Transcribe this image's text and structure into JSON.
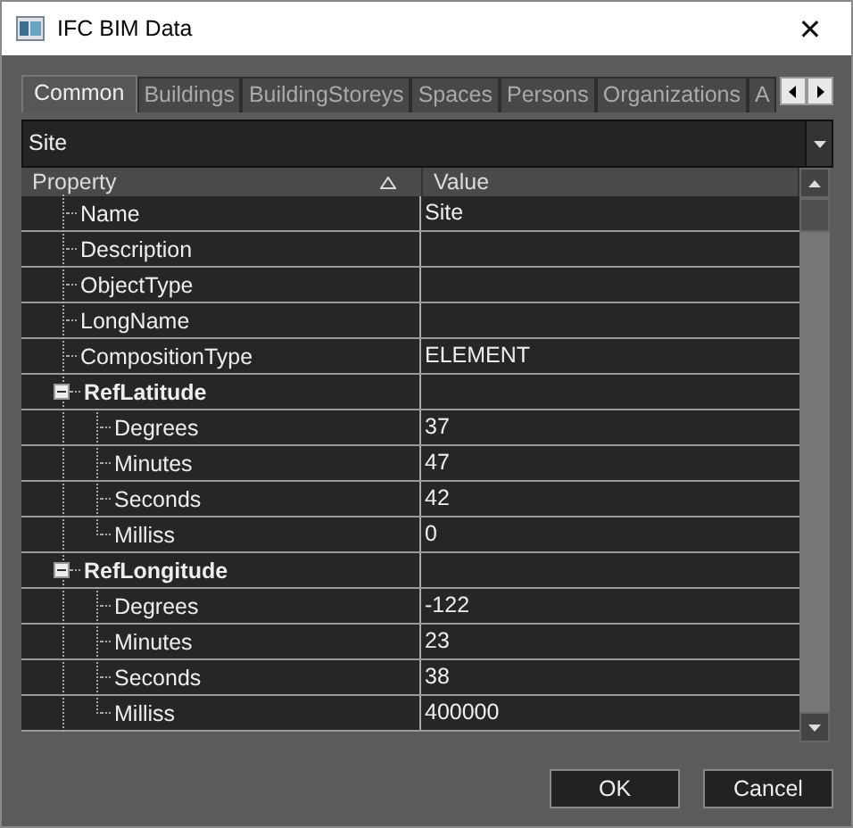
{
  "window": {
    "title": "IFC BIM Data",
    "close": "✕"
  },
  "tabs": [
    {
      "label": "Common",
      "selected": true
    },
    {
      "label": "Buildings",
      "selected": false
    },
    {
      "label": "BuildingStoreys",
      "selected": false
    },
    {
      "label": "Spaces",
      "selected": false
    },
    {
      "label": "Persons",
      "selected": false
    },
    {
      "label": "Organizations",
      "selected": false
    },
    {
      "label": "A",
      "selected": false
    }
  ],
  "selector": {
    "value": "Site"
  },
  "grid": {
    "columns": [
      "Property",
      "Value"
    ],
    "rows": [
      {
        "name": "Name",
        "value": "Site"
      },
      {
        "name": "Description",
        "value": ""
      },
      {
        "name": "ObjectType",
        "value": ""
      },
      {
        "name": "LongName",
        "value": ""
      },
      {
        "name": "CompositionType",
        "value": "ELEMENT"
      },
      {
        "name": "RefLatitude",
        "expanded": true,
        "children": [
          {
            "name": "Degrees",
            "value": "37"
          },
          {
            "name": "Minutes",
            "value": "47"
          },
          {
            "name": "Seconds",
            "value": "42"
          },
          {
            "name": "Milliss",
            "value": "0"
          }
        ]
      },
      {
        "name": "RefLongitude",
        "expanded": true,
        "children": [
          {
            "name": "Degrees",
            "value": "-122"
          },
          {
            "name": "Minutes",
            "value": "23"
          },
          {
            "name": "Seconds",
            "value": "38"
          },
          {
            "name": "Milliss",
            "value": "400000"
          }
        ]
      }
    ]
  },
  "buttons": [
    "OK",
    "Cancel"
  ]
}
